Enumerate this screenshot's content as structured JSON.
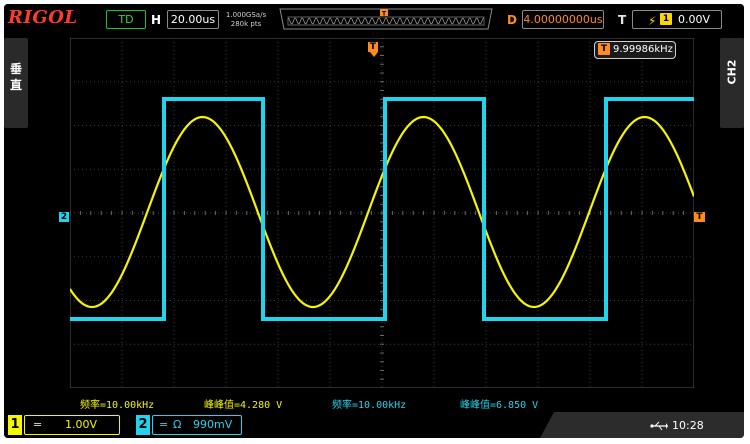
{
  "header": {
    "brand": "RIGOL",
    "run_status": "TD",
    "horizontal_label": "H",
    "timebase": "20.00us",
    "sample_rate": "1.000GSa/s",
    "mem_depth": "280k pts",
    "delay_label": "D",
    "delay_value": "4.00000000us",
    "trigger_label": "T",
    "trigger_source": "1",
    "trigger_level": "0.00V"
  },
  "side": {
    "left_tab": [
      "垂",
      "直"
    ],
    "right_tab": "CH2"
  },
  "markers": {
    "trigger_pos": "T",
    "ch2_ground": "2",
    "trigger_level": "T"
  },
  "freq_counter": {
    "icon_label": "T",
    "value": "9.99986kHz"
  },
  "measurements": [
    {
      "text": "频率=10.00kHz",
      "channel": "ch1"
    },
    {
      "text": "峰峰值=4.280 V",
      "channel": "ch1"
    },
    {
      "text": "频率=10.00kHz",
      "channel": "ch2"
    },
    {
      "text": "峰峰值=6.850 V",
      "channel": "ch2"
    }
  ],
  "channels": {
    "ch1": {
      "number": "1",
      "coupling": "=",
      "scale": "1.00V"
    },
    "ch2": {
      "number": "2",
      "coupling": "=",
      "impedance": "Ω",
      "scale": "990mV"
    }
  },
  "status": {
    "usb_icon": "usb-icon",
    "time": "10:28"
  },
  "colors": {
    "ch1": "#f5f500",
    "ch2": "#22d3ee",
    "trigger": "#ff8a1f",
    "brand": "#ff3b2f",
    "run": "#27d84a"
  }
}
